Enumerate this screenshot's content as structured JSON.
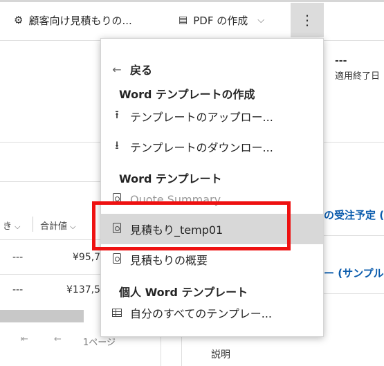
{
  "command_bar": {
    "quote_label": "顧客向け見積もりの...",
    "pdf_label": "PDF の作成",
    "more_glyph": "⋮"
  },
  "background": {
    "status_dash": "---",
    "status_label": "適用終了日",
    "col_headers": [
      "き",
      "合計値"
    ],
    "rows": [
      {
        "dash": "---",
        "value": "¥95,7"
      },
      {
        "dash": "---",
        "value": "¥137,5"
      }
    ],
    "pager_text": "1ページ",
    "right_link_1": "の受注予定 (",
    "right_link_2": "ー (サンプル",
    "description_label": "説明"
  },
  "menu": {
    "back_label": "戻る",
    "section_word_create": "Word テンプレートの作成",
    "upload_label": "テンプレートのアップロー...",
    "download_label": "テンプレートのダウンロー...",
    "section_word_templates": "Word テンプレート",
    "quote_summary_label": "Quote Summary",
    "selected_template_label": "見積もり_temp01",
    "overview_label": "見積もりの概要",
    "section_personal": "個人 Word テンプレート",
    "all_templates_label": "自分のすべてのテンプレー..."
  }
}
